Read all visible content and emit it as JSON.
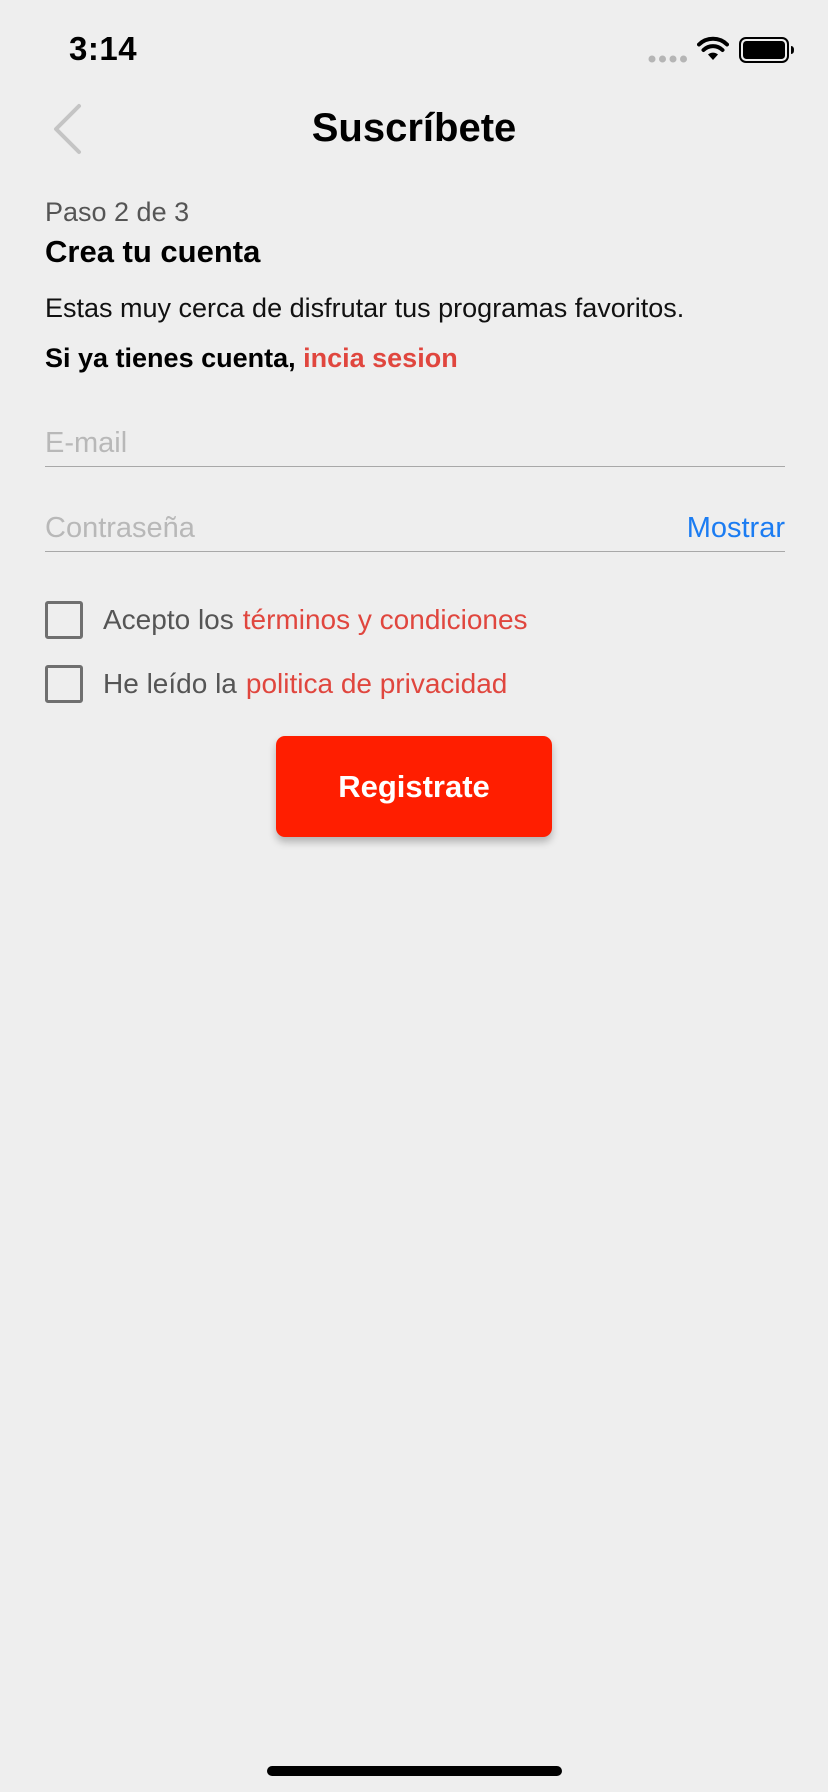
{
  "status_bar": {
    "time": "3:14",
    "icons": [
      "signal-dots-icon",
      "wifi-icon",
      "battery-icon"
    ]
  },
  "nav": {
    "title": "Suscríbete",
    "back_icon": "chevron-left-icon"
  },
  "form": {
    "step": "Paso 2 de 3",
    "title": "Crea tu cuenta",
    "intro": "Estas muy cerca de disfrutar tus programas favoritos.",
    "login_prompt": "Si ya tienes cuenta,",
    "login_link": "incia sesion",
    "email": {
      "placeholder": "E-mail",
      "value": ""
    },
    "password": {
      "placeholder": "Contraseña",
      "value": "",
      "show_label": "Mostrar"
    },
    "terms": {
      "text": "Acepto los",
      "link": "términos y condiciones",
      "checked": false
    },
    "privacy": {
      "text": "He leído la",
      "link": "politica de privacidad",
      "checked": false
    },
    "submit_label": "Registrate"
  },
  "colors": {
    "background": "#eeeeee",
    "accent_red": "#ff1e00",
    "link_red": "#e0463e",
    "link_blue": "#1b7cf2"
  }
}
